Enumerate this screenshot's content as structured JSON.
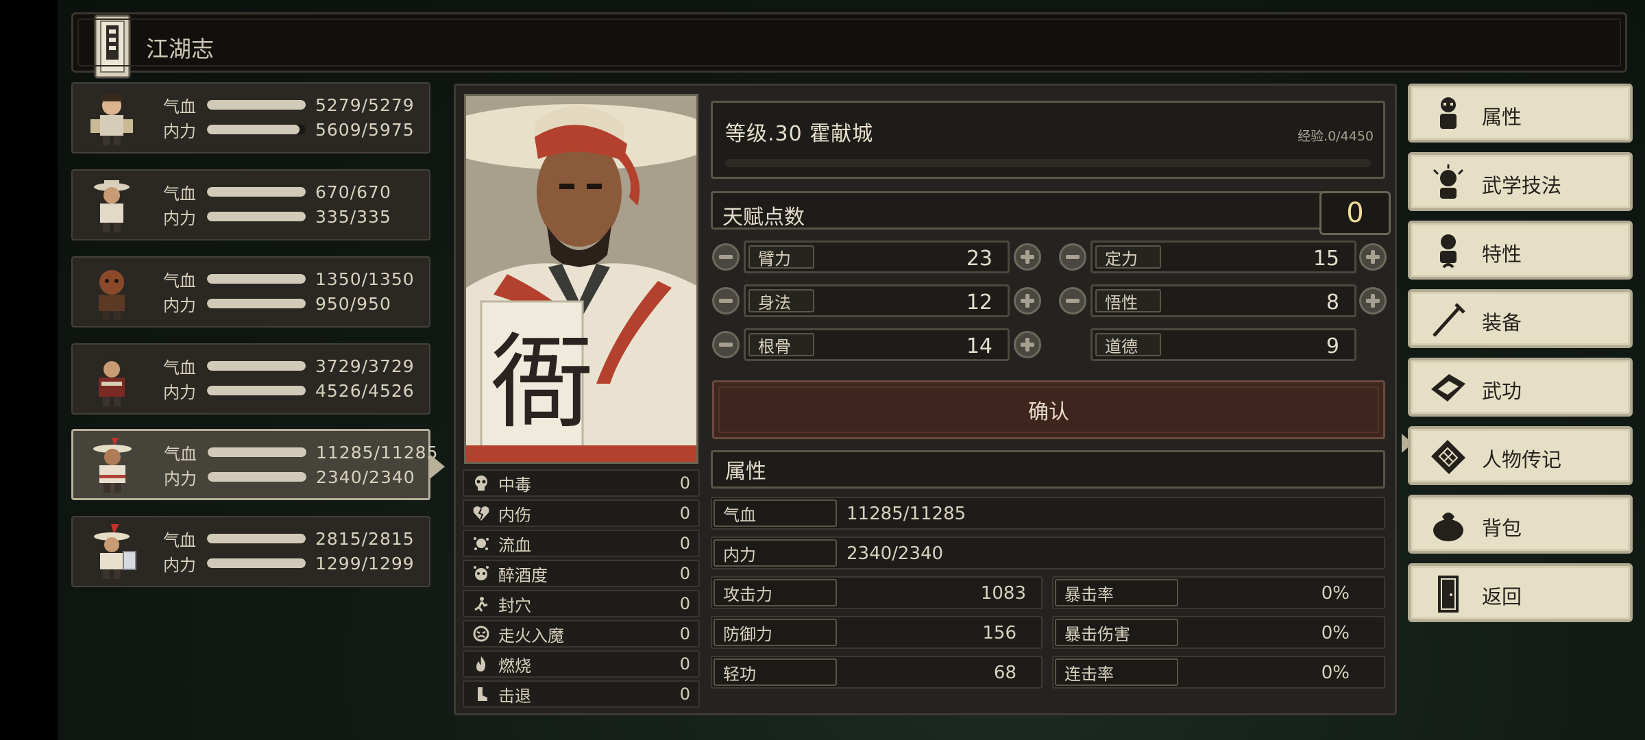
{
  "title": "江湖志",
  "party": [
    {
      "hp_label": "气血",
      "hp": "5279/5279",
      "hp_frac": 1.0,
      "mp_label": "内力",
      "mp": "5609/5975",
      "mp_frac": 0.94
    },
    {
      "hp_label": "气血",
      "hp": "670/670",
      "hp_frac": 1.0,
      "mp_label": "内力",
      "mp": "335/335",
      "mp_frac": 1.0
    },
    {
      "hp_label": "气血",
      "hp": "1350/1350",
      "hp_frac": 1.0,
      "mp_label": "内力",
      "mp": "950/950",
      "mp_frac": 1.0
    },
    {
      "hp_label": "气血",
      "hp": "3729/3729",
      "hp_frac": 1.0,
      "mp_label": "内力",
      "mp": "4526/4526",
      "mp_frac": 1.0
    },
    {
      "hp_label": "气血",
      "hp": "11285/11285",
      "hp_frac": 1.0,
      "mp_label": "内力",
      "mp": "2340/2340",
      "mp_frac": 1.0,
      "selected": true
    },
    {
      "hp_label": "气血",
      "hp": "2815/2815",
      "hp_frac": 1.0,
      "mp_label": "内力",
      "mp": "1299/1299",
      "mp_frac": 1.0
    }
  ],
  "level": {
    "text": "等级.30  霍献城",
    "exp": "经验.0/4450",
    "exp_frac": 0.0
  },
  "talent": {
    "label": "天赋点数",
    "value": "0"
  },
  "attributes": [
    {
      "label": "臂力",
      "value": "23",
      "adjustable": true
    },
    {
      "label": "定力",
      "value": "15",
      "adjustable": true
    },
    {
      "label": "身法",
      "value": "12",
      "adjustable": true
    },
    {
      "label": "悟性",
      "value": "8",
      "adjustable": true
    },
    {
      "label": "根骨",
      "value": "14",
      "adjustable": true
    },
    {
      "label": "道德",
      "value": "9",
      "adjustable": false
    }
  ],
  "confirm_label": "确认",
  "section_title": "属性",
  "stats": {
    "hp": {
      "label": "气血",
      "value": "11285/11285"
    },
    "mp": {
      "label": "内力",
      "value": "2340/2340"
    },
    "attack": {
      "label": "攻击力",
      "value": "1083"
    },
    "crit_rate": {
      "label": "暴击率",
      "value": "0%"
    },
    "defense": {
      "label": "防御力",
      "value": "156"
    },
    "crit_dmg": {
      "label": "暴击伤害",
      "value": "0%"
    },
    "qinggong": {
      "label": "轻功",
      "value": "68"
    },
    "combo_rate": {
      "label": "连击率",
      "value": "0%"
    }
  },
  "status_effects": [
    {
      "label": "中毒",
      "value": "0",
      "icon": "skull-icon"
    },
    {
      "label": "内伤",
      "value": "0",
      "icon": "broken-heart-icon"
    },
    {
      "label": "流血",
      "value": "0",
      "icon": "blood-splat-icon"
    },
    {
      "label": "醉酒度",
      "value": "0",
      "icon": "dizzy-icon"
    },
    {
      "label": "封穴",
      "value": "0",
      "icon": "acupoint-icon"
    },
    {
      "label": "走火入魔",
      "value": "0",
      "icon": "demon-face-icon"
    },
    {
      "label": "燃烧",
      "value": "0",
      "icon": "flame-icon"
    },
    {
      "label": "击退",
      "value": "0",
      "icon": "boot-icon"
    }
  ],
  "menu": [
    {
      "label": "属性",
      "icon": "character-icon"
    },
    {
      "label": "武学技法",
      "icon": "martial-skill-icon"
    },
    {
      "label": "特性",
      "icon": "trait-icon"
    },
    {
      "label": "装备",
      "icon": "sword-icon"
    },
    {
      "label": "武功",
      "icon": "manual-book-icon"
    },
    {
      "label": "人物传记",
      "icon": "biography-icon"
    },
    {
      "label": "背包",
      "icon": "bag-icon"
    },
    {
      "label": "返回",
      "icon": "door-icon"
    }
  ]
}
